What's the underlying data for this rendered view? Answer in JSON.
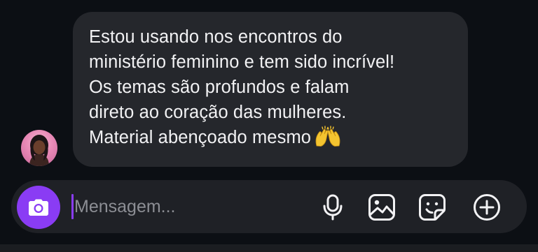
{
  "message": {
    "lines": [
      "Estou usando nos encontros do",
      "ministério feminino e tem sido incrível!",
      "Os temas são profundos e falam",
      "direto ao coração das mulheres.",
      "Material abençoado mesmo"
    ],
    "emoji": "raising-hands-emoji"
  },
  "composer": {
    "placeholder": "Mensagem...",
    "value": ""
  },
  "icons": {
    "camera": "camera-icon",
    "mic": "microphone-icon",
    "gallery": "image-icon",
    "sticker": "sticker-icon",
    "add": "plus-circle-icon"
  },
  "colors": {
    "background": "#0c0f14",
    "bubble": "#25272c",
    "composer": "#1f2126",
    "accent": "#8a3cf4",
    "text": "#f2f2f4",
    "placeholder": "#8c8e94"
  }
}
